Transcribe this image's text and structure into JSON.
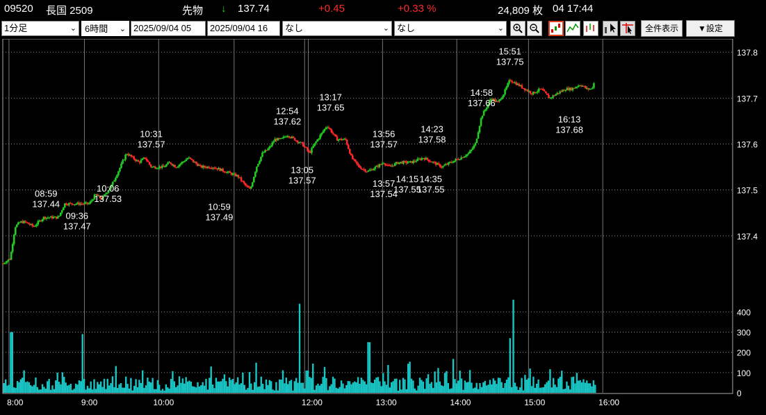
{
  "header": {
    "code": "09520",
    "name": "長国 2509",
    "type": "先物",
    "arrow": "↓",
    "price": "137.74",
    "change": "+0.45",
    "change_pct": "+0.33 %",
    "volume": "24,809 枚",
    "datetime": "04 17:44"
  },
  "toolbar": {
    "interval": "1分足",
    "span": "6時間",
    "start": "2025/09/04 05",
    "end": "2025/09/04 16",
    "indicator1": "なし",
    "indicator2": "なし",
    "zoom_in_icon": "magnifier-plus-icon",
    "zoom_out_icon": "magnifier-minus-icon",
    "full_label": "全件表示",
    "settings_label": "▼設定"
  },
  "colors": {
    "up": "#22cc22",
    "down": "#ff2a2a",
    "volume": "#19c4c4",
    "grid": "#8a8a8a",
    "session_line": "#777777"
  },
  "chart_data": {
    "type": "candlestick",
    "price_axis": {
      "ticks": [
        137.4,
        137.5,
        137.6,
        137.7,
        137.8
      ],
      "labels": [
        "137.4",
        "137.5",
        "137.6",
        "137.7",
        "137.8"
      ],
      "ylim": [
        137.315,
        137.82
      ]
    },
    "volume_axis": {
      "ticks": [
        0,
        100,
        200,
        300,
        400
      ],
      "labels": [
        "0",
        "100",
        "200",
        "300",
        "400"
      ],
      "ylim": [
        0,
        480
      ]
    },
    "time_axis": {
      "labels": [
        "8:00",
        "9:00",
        "10:00",
        "12:00",
        "13:00",
        "14:00",
        "15:00",
        "16:00"
      ],
      "minutes": [
        480,
        540,
        600,
        720,
        780,
        840,
        900,
        960
      ],
      "xlim": [
        470,
        1060
      ]
    },
    "session_lines_minutes": [
      475,
      536,
      596,
      657,
      714,
      717,
      777,
      837,
      895,
      955
    ],
    "price_path": [
      [
        470,
        137.34
      ],
      [
        476,
        137.35
      ],
      [
        480,
        137.42
      ],
      [
        484,
        137.43
      ],
      [
        488,
        137.43
      ],
      [
        495,
        137.42
      ],
      [
        503,
        137.44
      ],
      [
        510,
        137.44
      ],
      [
        515,
        137.44
      ],
      [
        520,
        137.47
      ],
      [
        530,
        137.47
      ],
      [
        540,
        137.47
      ],
      [
        545,
        137.49
      ],
      [
        550,
        137.48
      ],
      [
        558,
        137.51
      ],
      [
        565,
        137.55
      ],
      [
        570,
        137.58
      ],
      [
        575,
        137.57
      ],
      [
        580,
        137.56
      ],
      [
        585,
        137.57
      ],
      [
        590,
        137.55
      ],
      [
        600,
        137.55
      ],
      [
        605,
        137.56
      ],
      [
        610,
        137.55
      ],
      [
        620,
        137.57
      ],
      [
        630,
        137.55
      ],
      [
        640,
        137.55
      ],
      [
        650,
        137.54
      ],
      [
        660,
        137.53
      ],
      [
        666,
        137.51
      ],
      [
        670,
        137.5
      ],
      [
        675,
        137.55
      ],
      [
        680,
        137.58
      ],
      [
        685,
        137.59
      ],
      [
        690,
        137.61
      ],
      [
        695,
        137.61
      ],
      [
        700,
        137.62
      ],
      [
        706,
        137.61
      ],
      [
        712,
        137.6
      ],
      [
        718,
        137.58
      ],
      [
        722,
        137.6
      ],
      [
        727,
        137.62
      ],
      [
        732,
        137.64
      ],
      [
        735,
        137.63
      ],
      [
        740,
        137.61
      ],
      [
        747,
        137.61
      ],
      [
        752,
        137.57
      ],
      [
        758,
        137.55
      ],
      [
        765,
        137.54
      ],
      [
        772,
        137.55
      ],
      [
        778,
        137.56
      ],
      [
        782,
        137.55
      ],
      [
        790,
        137.56
      ],
      [
        800,
        137.56
      ],
      [
        810,
        137.57
      ],
      [
        818,
        137.56
      ],
      [
        825,
        137.55
      ],
      [
        832,
        137.56
      ],
      [
        840,
        137.57
      ],
      [
        847,
        137.58
      ],
      [
        852,
        137.6
      ],
      [
        857,
        137.66
      ],
      [
        861,
        137.68
      ],
      [
        865,
        137.7
      ],
      [
        870,
        137.69
      ],
      [
        875,
        137.71
      ],
      [
        880,
        137.74
      ],
      [
        886,
        137.73
      ],
      [
        892,
        137.72
      ],
      [
        898,
        137.71
      ],
      [
        905,
        137.72
      ],
      [
        912,
        137.7
      ],
      [
        918,
        137.71
      ],
      [
        925,
        137.72
      ],
      [
        930,
        137.72
      ],
      [
        937,
        137.73
      ],
      [
        942,
        137.72
      ],
      [
        946,
        137.72
      ],
      [
        949,
        137.74
      ]
    ],
    "annotations": [
      {
        "time": "08:59",
        "price": "137.44",
        "t": 505,
        "p": 137.44,
        "pos": "above"
      },
      {
        "time": "09:36",
        "price": "137.47",
        "t": 530,
        "p": 137.47,
        "pos": "below"
      },
      {
        "time": "10:06",
        "price": "137.53",
        "t": 555,
        "p": 137.53,
        "pos": "below"
      },
      {
        "time": "10:31",
        "price": "137.57",
        "t": 590,
        "p": 137.57,
        "pos": "above"
      },
      {
        "time": "10:59",
        "price": "137.49",
        "t": 645,
        "p": 137.49,
        "pos": "below"
      },
      {
        "time": "12:54",
        "price": "137.62",
        "t": 700,
        "p": 137.62,
        "pos": "above"
      },
      {
        "time": "13:05",
        "price": "137.57",
        "t": 712,
        "p": 137.57,
        "pos": "below"
      },
      {
        "time": "13:17",
        "price": "137.65",
        "t": 735,
        "p": 137.65,
        "pos": "above"
      },
      {
        "time": "13:56",
        "price": "137.57",
        "t": 778,
        "p": 137.57,
        "pos": "above"
      },
      {
        "time": "13:57",
        "price": "137.54",
        "t": 778,
        "p": 137.54,
        "pos": "below"
      },
      {
        "time": "14:15",
        "price": "137.55",
        "t": 797,
        "p": 137.55,
        "pos": "below"
      },
      {
        "time": "14:23",
        "price": "137.58",
        "t": 817,
        "p": 137.58,
        "pos": "above"
      },
      {
        "time": "14:35",
        "price": "137.55",
        "t": 816,
        "p": 137.55,
        "pos": "below"
      },
      {
        "time": "14:58",
        "price": "137.66",
        "t": 857,
        "p": 137.66,
        "pos": "above"
      },
      {
        "time": "15:51",
        "price": "137.75",
        "t": 880,
        "p": 137.75,
        "pos": "above"
      },
      {
        "time": "16:13",
        "price": "137.68",
        "t": 928,
        "p": 137.68,
        "pos": "below"
      }
    ]
  }
}
